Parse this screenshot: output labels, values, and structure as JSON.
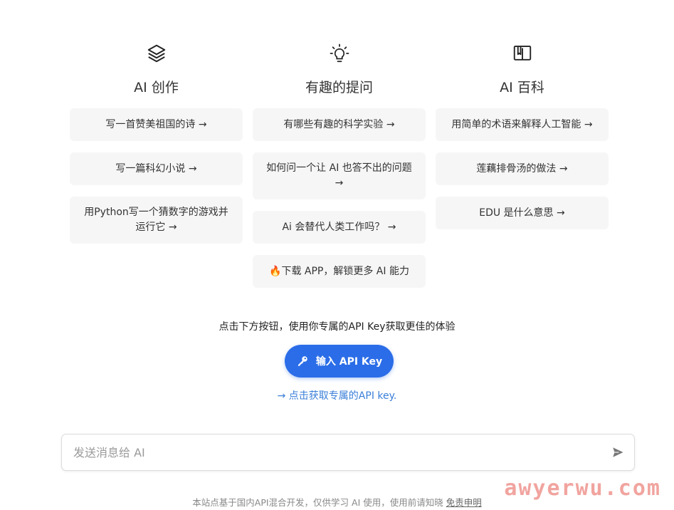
{
  "columns": [
    {
      "icon": "layers-icon",
      "title": "AI 创作",
      "cards": [
        "写一首赞美祖国的诗 →",
        "写一篇科幻小说 →",
        "用Python写一个猜数字的游戏并运行它 →"
      ]
    },
    {
      "icon": "lightbulb-icon",
      "title": "有趣的提问",
      "cards": [
        "有哪些有趣的科学实验 →",
        "如何问一个让 AI 也答不出的问题 →",
        "Ai 会替代人类工作吗？ →",
        "🔥下载 APP，解锁更多 AI 能力"
      ]
    },
    {
      "icon": "book-icon",
      "title": "AI 百科",
      "cards": [
        "用简单的术语来解释人工智能 →",
        "莲藕排骨汤的做法 →",
        "EDU 是什么意思 →"
      ]
    }
  ],
  "api": {
    "hint": "点击下方按钮，使用你专属的API Key获取更佳的体验",
    "button_label": "输入 API Key",
    "button_icon": "key-icon",
    "link_text": "→ 点击获取专属的API key."
  },
  "input": {
    "placeholder": "发送消息给 AI",
    "value": "",
    "send_icon": "send-icon"
  },
  "footer": {
    "text": "本站点基于国内API混合开发，仅供学习 AI 使用，使用前请知晓 ",
    "disclaimer_link": "免责申明"
  },
  "watermark": "awyerwu.com",
  "colors": {
    "accent": "#2b6de8",
    "link": "#3a7fd9",
    "card_bg": "#f6f6f6"
  }
}
